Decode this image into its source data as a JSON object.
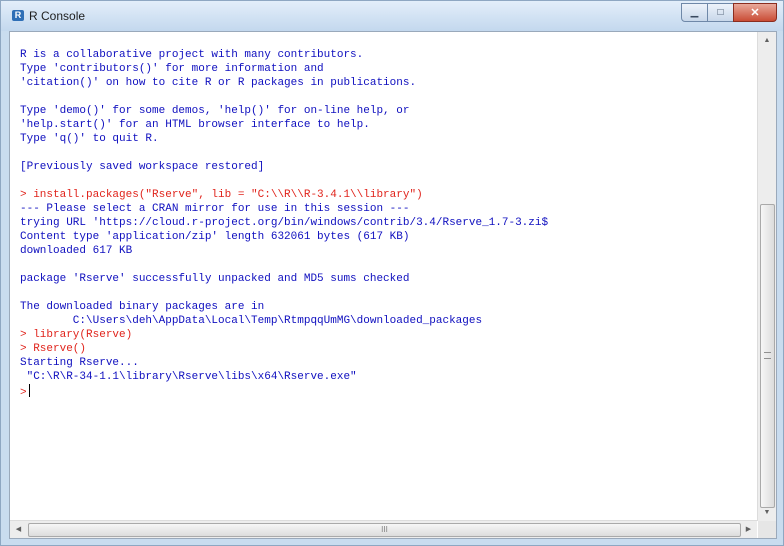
{
  "window": {
    "title": "R Console",
    "app_icon_glyph": "R",
    "buttons": {
      "minimize": "minimize-icon",
      "maximize": "maximize-icon",
      "close": "close-icon"
    }
  },
  "console": {
    "lines": [
      {
        "text": "R is a collaborative project with many contributors.",
        "type": "output"
      },
      {
        "text": "Type 'contributors()' for more information and",
        "type": "output"
      },
      {
        "text": "'citation()' on how to cite R or R packages in publications.",
        "type": "output"
      },
      {
        "text": "",
        "type": "output"
      },
      {
        "text": "Type 'demo()' for some demos, 'help()' for on-line help, or",
        "type": "output"
      },
      {
        "text": "'help.start()' for an HTML browser interface to help.",
        "type": "output"
      },
      {
        "text": "Type 'q()' to quit R.",
        "type": "output"
      },
      {
        "text": "",
        "type": "output"
      },
      {
        "text": "[Previously saved workspace restored]",
        "type": "output"
      },
      {
        "text": "",
        "type": "output"
      },
      {
        "text": "> install.packages(\"Rserve\", lib = \"C:\\\\R\\\\R-3.4.1\\\\library\")",
        "type": "cmd"
      },
      {
        "text": "--- Please select a CRAN mirror for use in this session ---",
        "type": "output"
      },
      {
        "text": "trying URL 'https://cloud.r-project.org/bin/windows/contrib/3.4/Rserve_1.7-3.zi$",
        "type": "output"
      },
      {
        "text": "Content type 'application/zip' length 632061 bytes (617 KB)",
        "type": "output"
      },
      {
        "text": "downloaded 617 KB",
        "type": "output"
      },
      {
        "text": "",
        "type": "output"
      },
      {
        "text": "package 'Rserve' successfully unpacked and MD5 sums checked",
        "type": "output"
      },
      {
        "text": "",
        "type": "output"
      },
      {
        "text": "The downloaded binary packages are in",
        "type": "output"
      },
      {
        "text": "        C:\\Users\\deh\\AppData\\Local\\Temp\\RtmpqqUmMG\\downloaded_packages",
        "type": "output"
      },
      {
        "text": "> library(Rserve)",
        "type": "cmd"
      },
      {
        "text": "> Rserve()",
        "type": "cmd"
      },
      {
        "text": "Starting Rserve...",
        "type": "output"
      },
      {
        "text": " \"C:\\R\\R-34-1.1\\library\\Rserve\\libs\\x64\\Rserve.exe\"",
        "type": "output"
      }
    ],
    "prompt": ">"
  },
  "scrollbars": {
    "vertical": {
      "up": "arrow-up-icon",
      "down": "arrow-down-icon"
    },
    "horizontal": {
      "left": "arrow-left-icon",
      "right": "arrow-right-icon",
      "grip": "III"
    }
  }
}
